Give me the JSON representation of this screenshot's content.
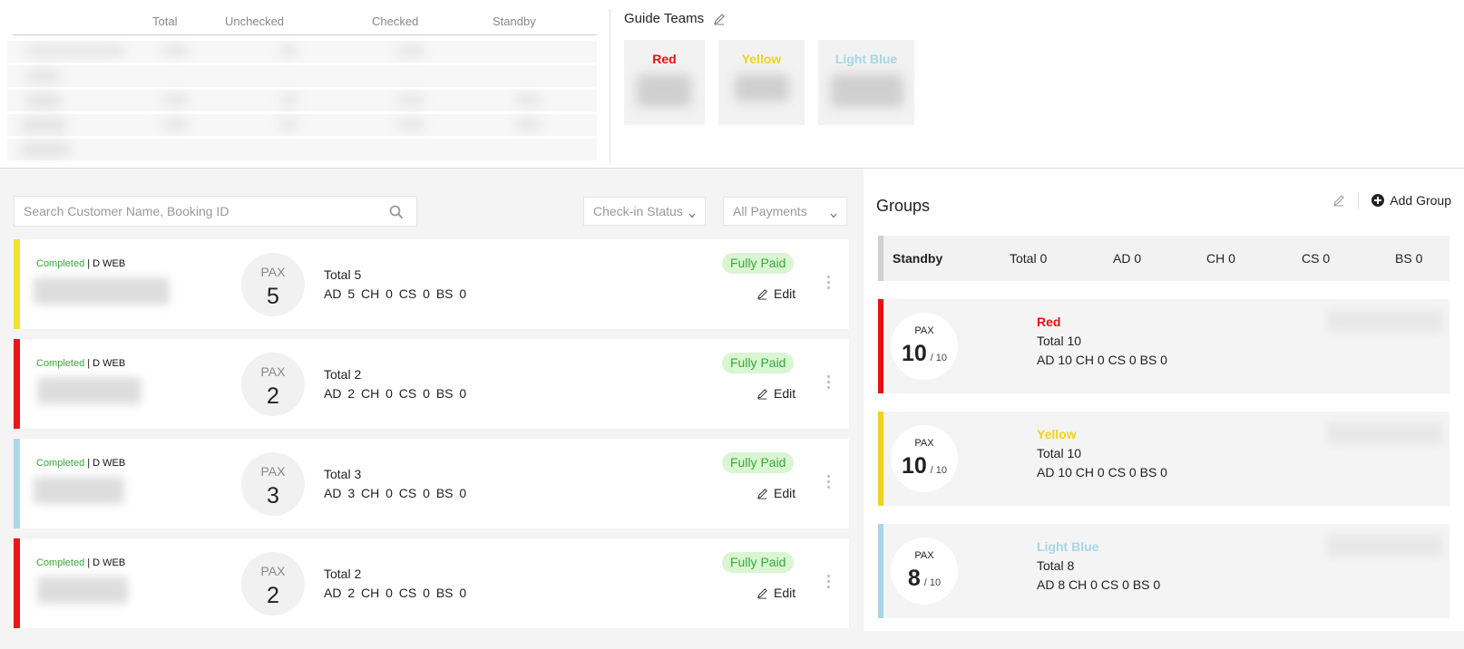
{
  "summary": {
    "headers": [
      "Total",
      "Unchecked",
      "Checked",
      "Standby"
    ]
  },
  "guide_teams": {
    "title": "Guide Teams",
    "teams": [
      {
        "name": "Red",
        "color": "#e81010"
      },
      {
        "name": "Yellow",
        "color": "#f2d21e"
      },
      {
        "name": "Light Blue",
        "color": "#a8d6e6"
      }
    ]
  },
  "filters": {
    "search_placeholder": "Search Customer Name, Booking ID",
    "checkin_status": "Check-in Status",
    "payments": "All Payments"
  },
  "bookings": [
    {
      "status": "Completed",
      "source": "| D WEB",
      "pax_label": "PAX",
      "pax": "5",
      "total": "Total 5",
      "detail": "AD 5  CH 0  CS 0  BS 0",
      "payment": "Fully Paid",
      "edit": "Edit",
      "color": "#f2e22e"
    },
    {
      "status": "Completed",
      "source": "| D WEB",
      "pax_label": "PAX",
      "pax": "2",
      "total": "Total 2",
      "detail": "AD 2  CH 0  CS 0  BS 0",
      "payment": "Fully Paid",
      "edit": "Edit",
      "color": "#e81818"
    },
    {
      "status": "Completed",
      "source": "| D WEB",
      "pax_label": "PAX",
      "pax": "3",
      "total": "Total 3",
      "detail": "AD 3  CH 0  CS 0  BS 0",
      "payment": "Fully Paid",
      "edit": "Edit",
      "color": "#add8e6"
    },
    {
      "status": "Completed",
      "source": "| D WEB",
      "pax_label": "PAX",
      "pax": "2",
      "total": "Total 2",
      "detail": "AD 2  CH 0  CS 0  BS 0",
      "payment": "Fully Paid",
      "edit": "Edit",
      "color": "#e81818"
    }
  ],
  "groups": {
    "title": "Groups",
    "add_label": "Add Group",
    "standby": {
      "label": "Standby",
      "total": "Total 0",
      "ad": "AD 0",
      "ch": "CH 0",
      "cs": "CS 0",
      "bs": "BS 0"
    },
    "cards": [
      {
        "name": "Red",
        "color": "#e81010",
        "pax_label": "PAX",
        "pax": "10",
        "cap": "/ 10",
        "total": "Total 10",
        "detail": "AD 10 CH 0 CS 0 BS 0"
      },
      {
        "name": "Yellow",
        "color": "#f2d21e",
        "pax_label": "PAX",
        "pax": "10",
        "cap": "/ 10",
        "total": "Total 10",
        "detail": "AD 10 CH 0 CS 0 BS 0"
      },
      {
        "name": "Light Blue",
        "color": "#a8d6e6",
        "pax_label": "PAX",
        "pax": "8",
        "cap": "/ 10",
        "total": "Total 8",
        "detail": "AD 8 CH 0 CS 0 BS 0"
      }
    ]
  }
}
